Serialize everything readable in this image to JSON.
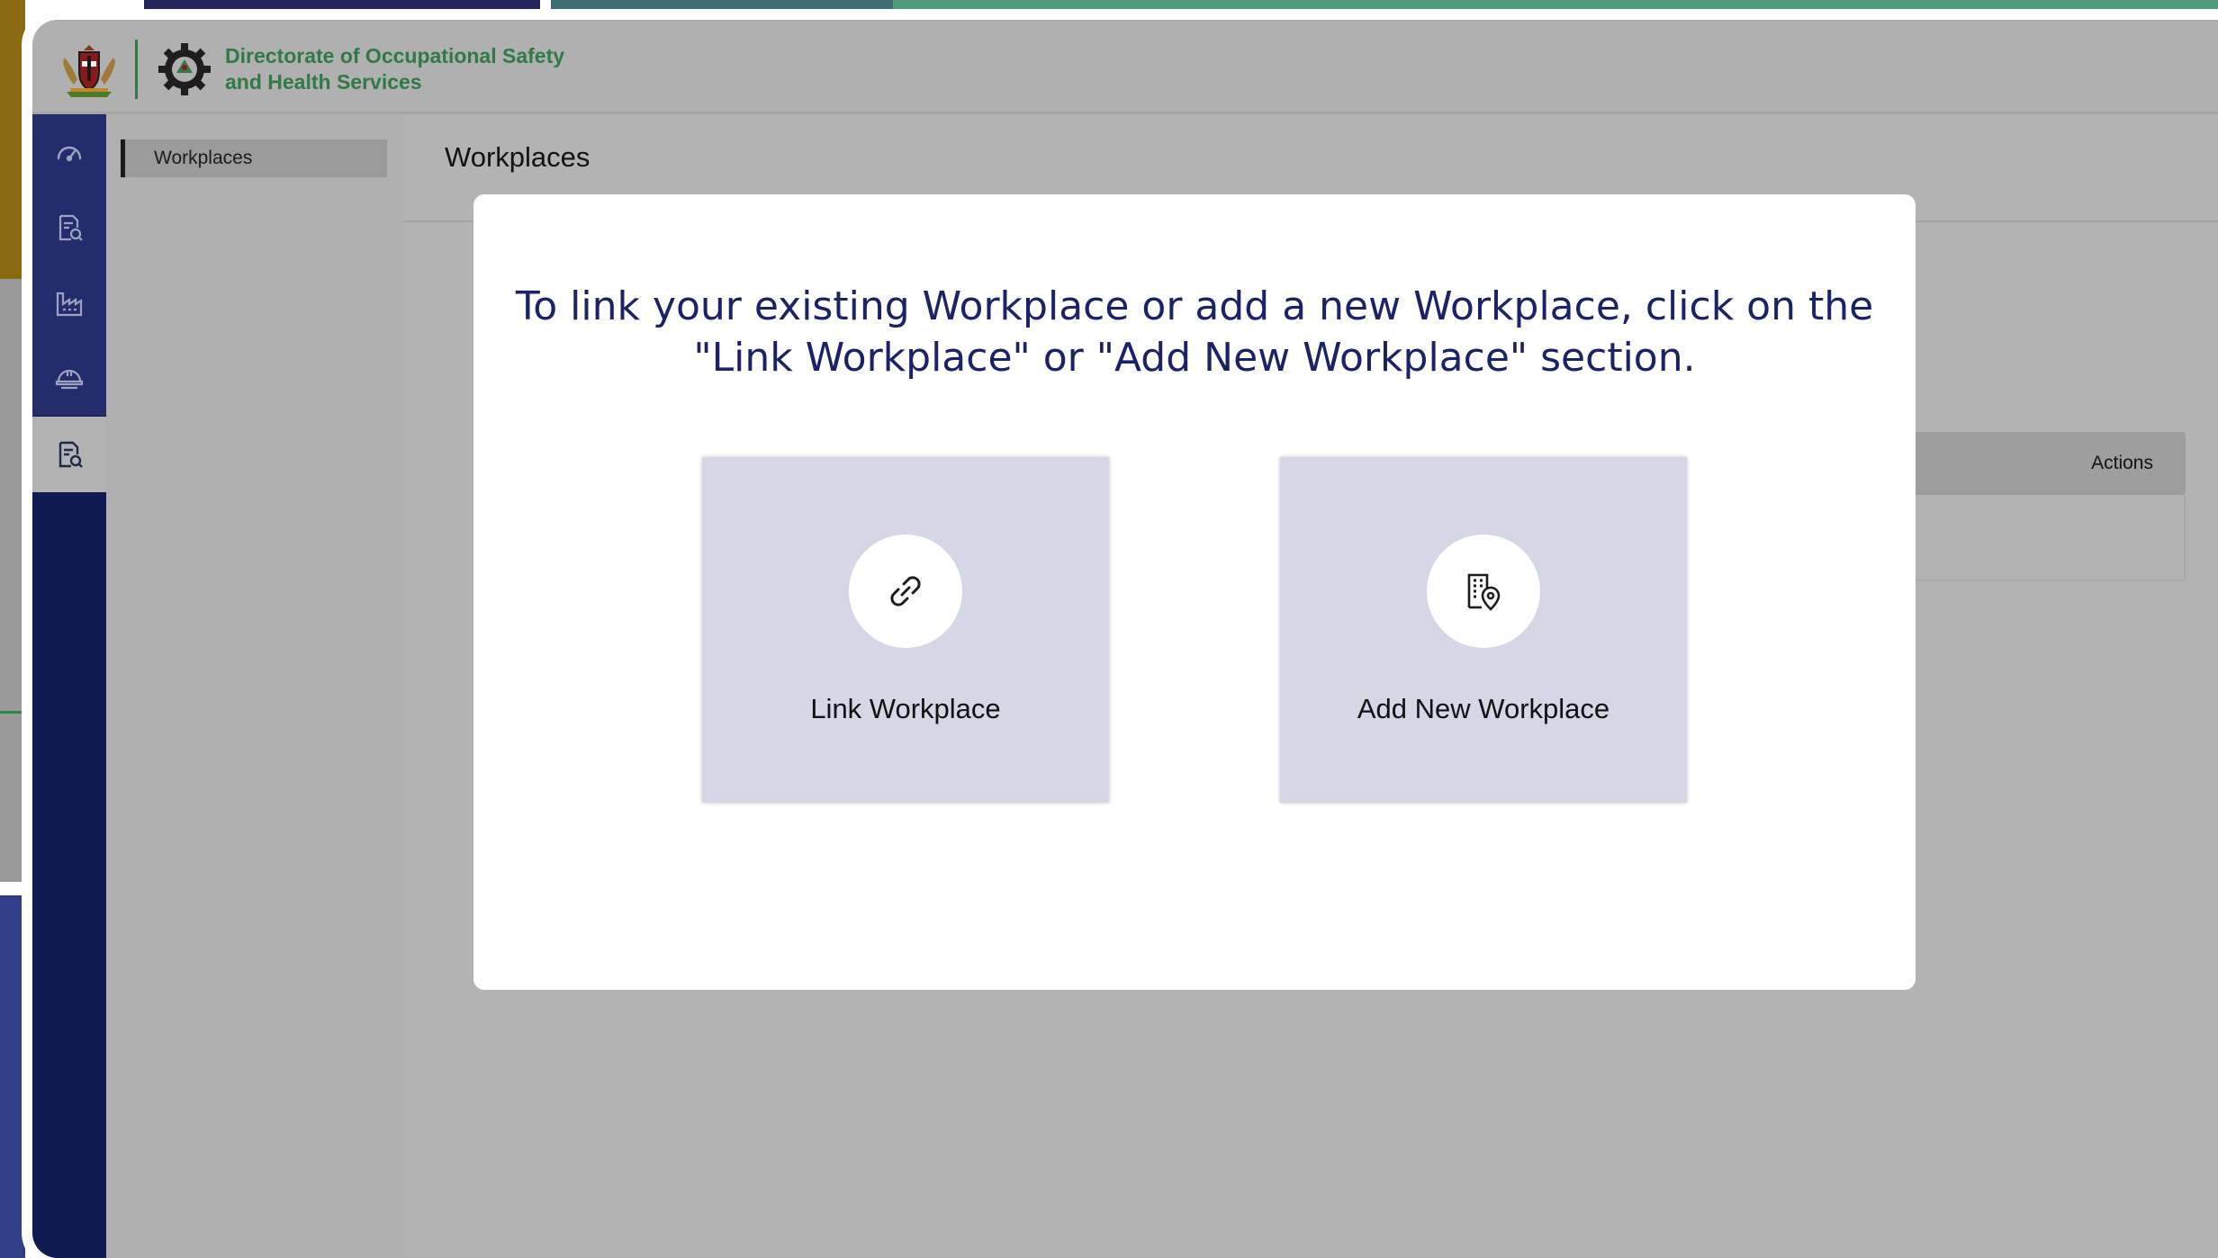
{
  "header": {
    "brand_line1": "Directorate of Occupational Safety",
    "brand_line2": "and Health Services"
  },
  "rail": {
    "icons": [
      "dashboard-icon",
      "document-search-icon",
      "factory-icon",
      "worker-helmet-icon",
      "workplace-document-icon"
    ],
    "active_index": 4
  },
  "subnav": {
    "items": [
      {
        "label": "Workplaces"
      }
    ]
  },
  "main": {
    "title": "Workplaces",
    "table": {
      "columns": [
        "Actions"
      ]
    }
  },
  "modal": {
    "heading": "To link your existing Workplace or add a new Workplace, click on the \"Link Workplace\" or \"Add New Workplace\" section.",
    "options": [
      {
        "label": "Link Workplace",
        "icon": "link-icon"
      },
      {
        "label": "Add New Workplace",
        "icon": "building-location-icon"
      }
    ]
  },
  "colors": {
    "brand_green": "#2f7a45",
    "rail_navy": "#0f1a52",
    "heading_navy": "#1b2268",
    "card_bg": "#d5d6e6",
    "overlay_grey": "#b3b3b3"
  }
}
